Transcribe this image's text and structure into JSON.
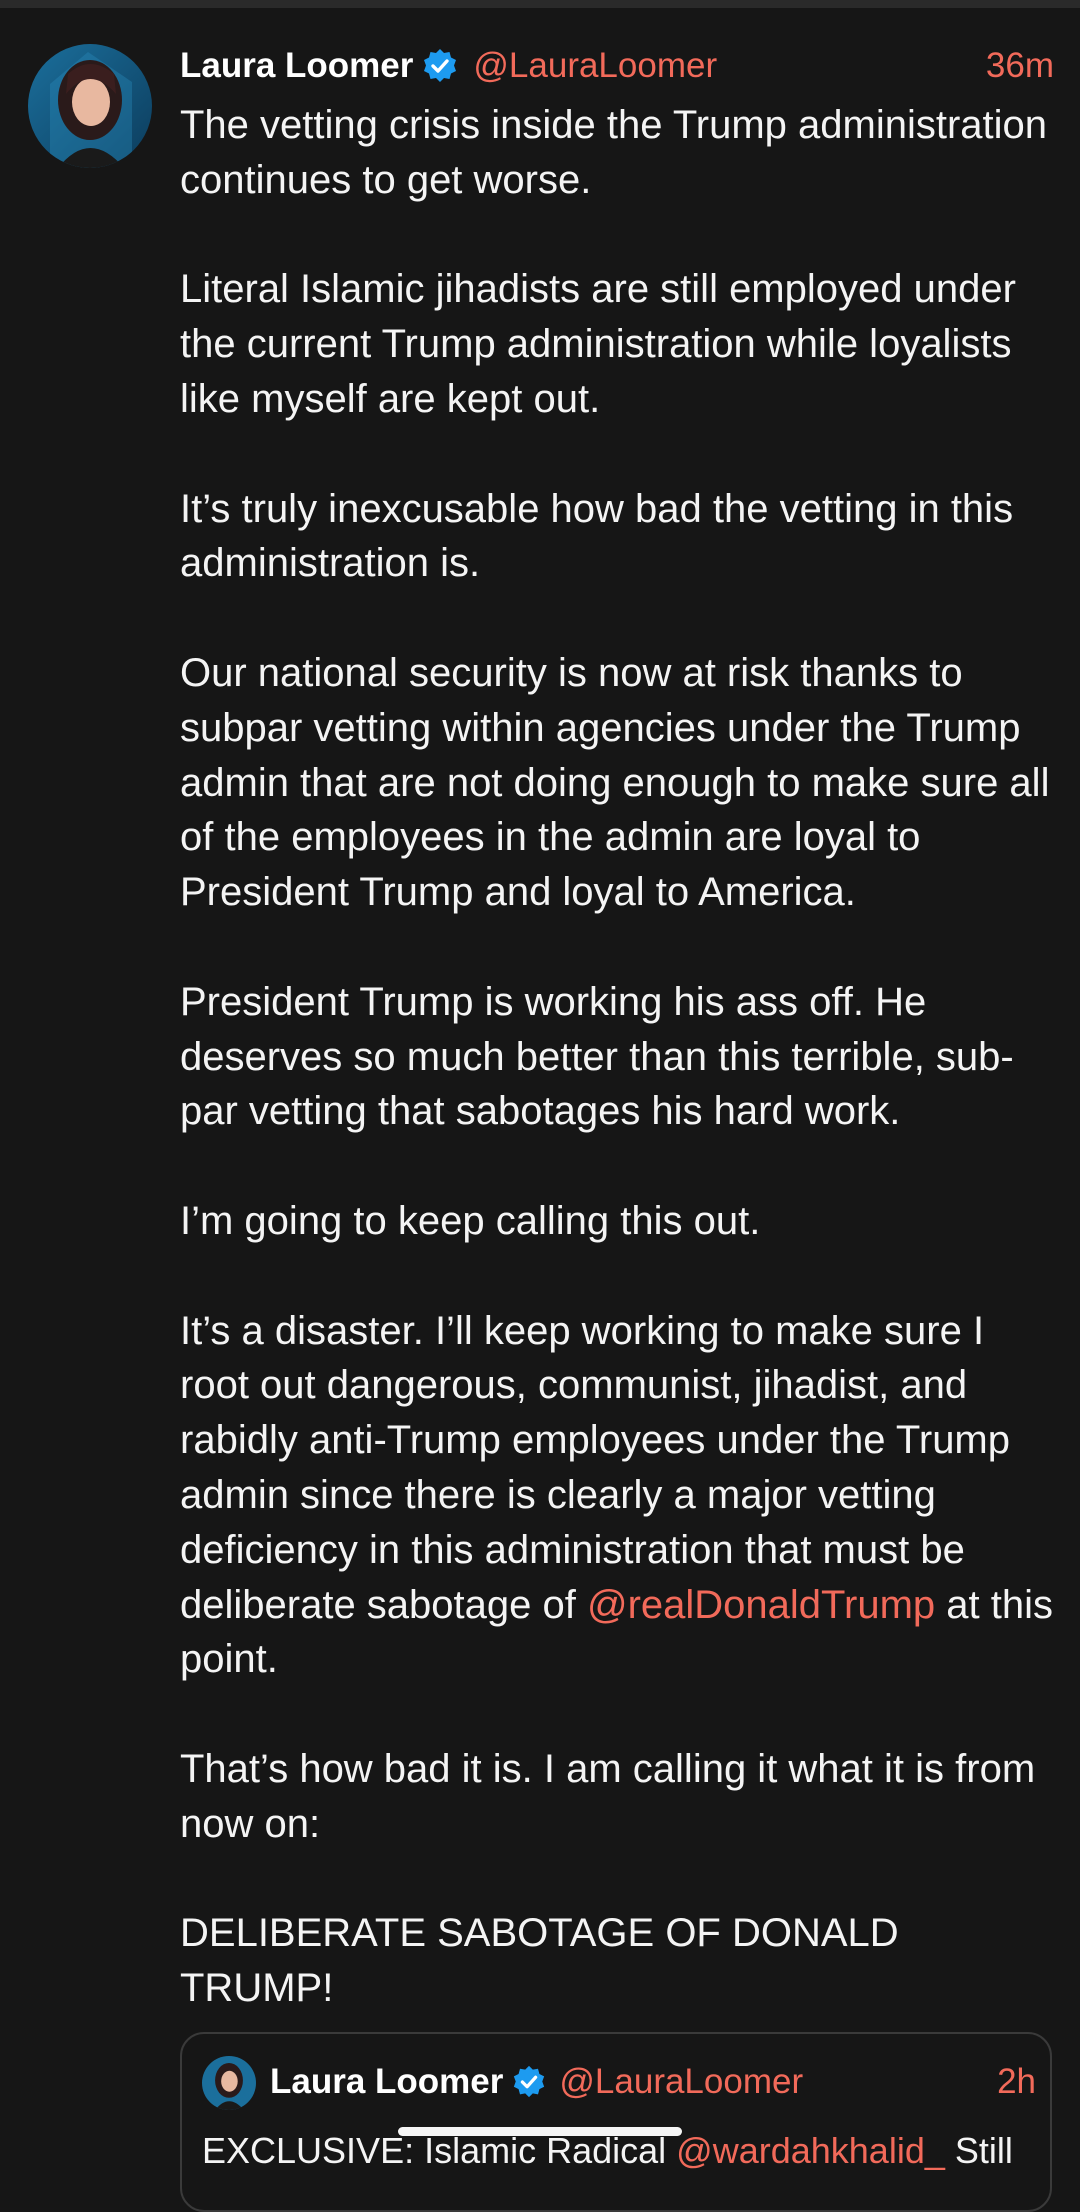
{
  "post": {
    "author_name": "Laura Loomer",
    "handle": "@LauraLoomer",
    "time": "36m",
    "paragraphs": {
      "p1": "The vetting crisis inside the Trump administration continues to get worse.",
      "p2": "Literal Islamic jihadists are still employed under the current Trump administration while loyalists like myself are kept out.",
      "p3": "It’s truly inexcusable how bad the vetting in this administration is.",
      "p4": "Our national security is now at risk thanks to subpar vetting within agencies under the Trump admin that are not doing enough to make sure all of the employees in the admin are loyal to President Trump and loyal to America.",
      "p5": "President Trump is working his ass off. He deserves so much better than this terrible, sub-par vetting that sabotages his hard work.",
      "p6": "I’m going to keep calling this out.",
      "p7_before": "It’s a disaster. I’ll keep working to make sure I root out dangerous, communist, jihadist, and rabidly anti-Trump employees under the Trump admin since there is clearly a major vetting deficiency in this administration that must be deliberate sabotage of ",
      "p7_mention": "@realDonaldTrump",
      "p7_after": " at this point.",
      "p8": "That’s how bad it is. I am calling it what it is from now on:",
      "p9": "DELIBERATE SABOTAGE OF DONALD TRUMP!"
    }
  },
  "quoted_post": {
    "author_name": "Laura Loomer",
    "handle": "@LauraLoomer",
    "time": "2h",
    "text_before": "EXCLUSIVE: Islamic Radical ",
    "mention": "@wardahkhalid_",
    "text_after": " Still"
  },
  "colors": {
    "background": "#161616",
    "accent": "#f26a5a",
    "verified": "#1d9bf0",
    "text": "#f4f4f4"
  },
  "icons": {
    "verified": "verified-badge-icon",
    "avatar": "profile-avatar"
  }
}
